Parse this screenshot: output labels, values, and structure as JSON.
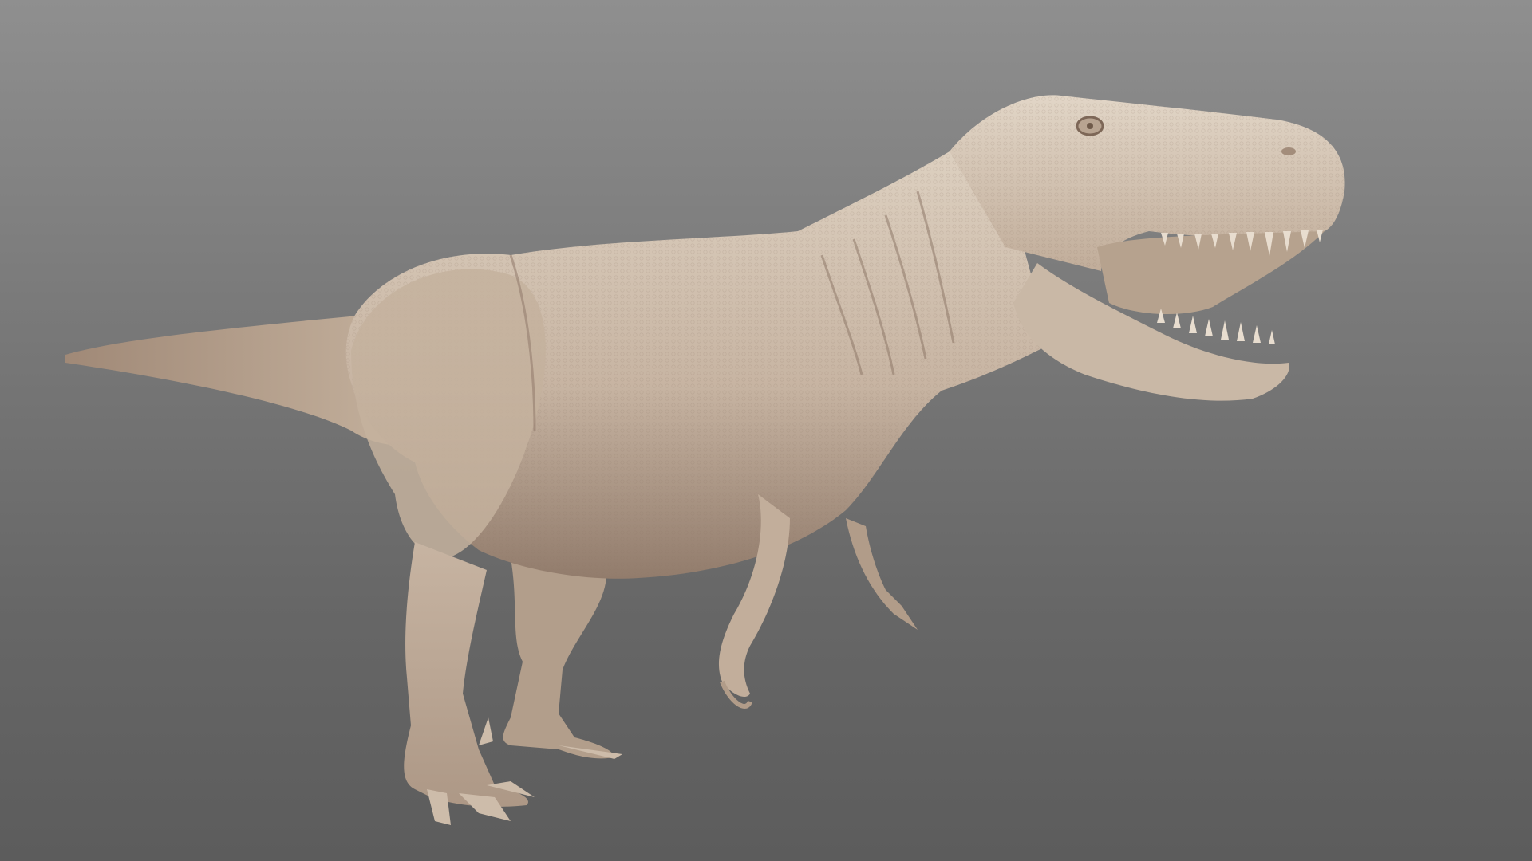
{
  "scene": {
    "subject": "",
    "background_top": "#8f8f8f",
    "background_bottom": "#5c5c5c",
    "model_base_color": "#c9b8a6",
    "model_shadow_color": "#8d7766",
    "model_highlight_color": "#ddd0c0"
  }
}
